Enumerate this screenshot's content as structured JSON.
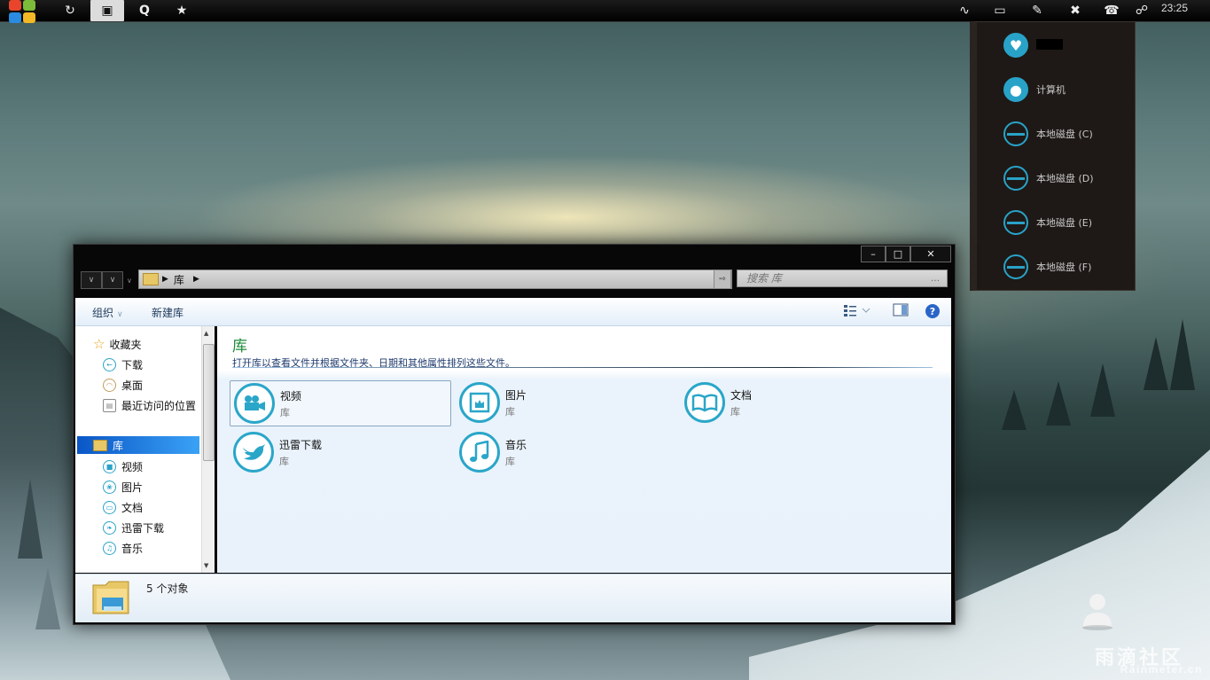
{
  "taskbar": {
    "clock": "23:25",
    "left_icons": [
      "refresh-icon",
      "explorer-icon",
      "search-q-icon",
      "star-icon"
    ],
    "tray_icons": [
      "activity-icon",
      "monitor-icon",
      "paint-icon",
      "tools-icon",
      "phone-icon",
      "network-icon"
    ]
  },
  "drive_panel": {
    "items": [
      {
        "label": "",
        "icon": "heart-icon"
      },
      {
        "label": "计算机",
        "icon": "apple-icon"
      },
      {
        "label": "本地磁盘 (C)",
        "icon": "drive-icon"
      },
      {
        "label": "本地磁盘 (D)",
        "icon": "drive-icon"
      },
      {
        "label": "本地磁盘 (E)",
        "icon": "drive-icon"
      },
      {
        "label": "本地磁盘 (F)",
        "icon": "drive-icon"
      }
    ],
    "accent": "#29a2c8"
  },
  "explorer": {
    "address": {
      "path": "库"
    },
    "search": {
      "placeholder": "搜索 库"
    },
    "toolbar": {
      "organize": "组织",
      "new_library": "新建库"
    },
    "sidebar": {
      "favorites_header": "收藏夹",
      "favorites": [
        "下载",
        "桌面",
        "最近访问的位置"
      ],
      "library_header": "库",
      "libraries": [
        "视频",
        "图片",
        "文档",
        "迅雷下载",
        "音乐"
      ]
    },
    "content": {
      "title": "库",
      "description": "打开库以查看文件并根据文件夹、日期和其他属性排列这些文件。",
      "tiles": [
        {
          "name": "视频",
          "sub": "库",
          "icon": "video-camera-icon"
        },
        {
          "name": "图片",
          "sub": "库",
          "icon": "picture-icon"
        },
        {
          "name": "文档",
          "sub": "库",
          "icon": "book-icon"
        },
        {
          "name": "迅雷下载",
          "sub": "库",
          "icon": "bird-icon"
        },
        {
          "name": "音乐",
          "sub": "库",
          "icon": "music-note-icon"
        }
      ]
    },
    "status": {
      "count_text": "5 个对象"
    }
  },
  "watermark": {
    "text": "雨滴社区",
    "sub": "Rainmeter.cn"
  }
}
